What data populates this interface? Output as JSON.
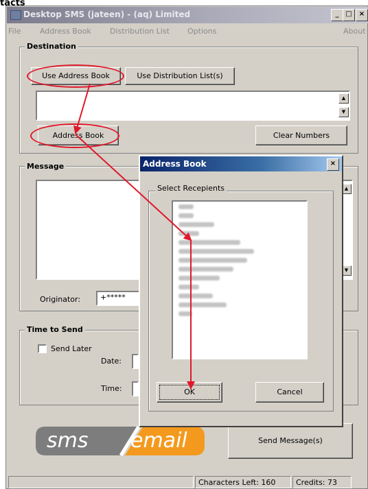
{
  "top_crop_text": "tacts",
  "window": {
    "title": "Desktop SMS (jateen) - (aq) Limited",
    "about_label": "About"
  },
  "menu": [
    "File",
    "Address Book",
    "Distribution List",
    "Options"
  ],
  "destination": {
    "group_label": "Destination",
    "use_address_book": "Use Address Book",
    "use_distribution_list": "Use Distribution List(s)",
    "address_book_button": "Address Book",
    "clear_numbers_button": "Clear Numbers"
  },
  "message": {
    "group_label": "Message",
    "originator_label": "Originator:",
    "originator_value": "+*****"
  },
  "time_to_send": {
    "group_label": "Time to Send",
    "send_later_label": "Send Later",
    "date_label": "Date:",
    "time_label": "Time:"
  },
  "logo": {
    "left": "sms",
    "right": "email"
  },
  "send_button": "Send Message(s)",
  "status": {
    "characters_left": "Characters Left: 160",
    "credits": "Credits: 73"
  },
  "address_book_dialog": {
    "title": "Address Book",
    "select_label": "Select Recepients",
    "ok_button": "OK",
    "cancel_button": "Cancel"
  },
  "colors": {
    "annotation_red": "#e0182a",
    "logo_grey": "#7d7d7d",
    "logo_orange": "#f39a1e"
  }
}
